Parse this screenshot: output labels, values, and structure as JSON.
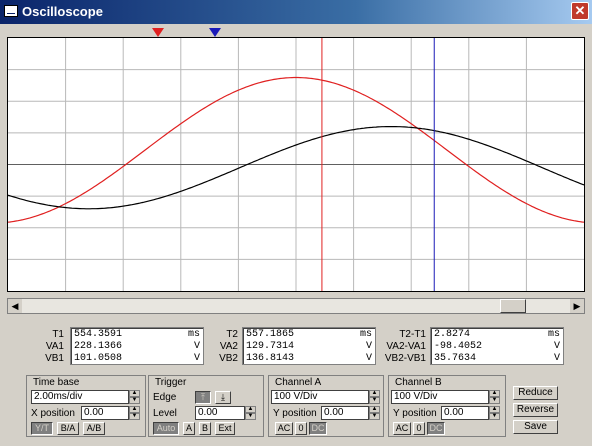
{
  "window": {
    "title": "Oscilloscope",
    "close_label": "✕",
    "icon": "oscilloscope-icon"
  },
  "cursors": {
    "c1_label": "1",
    "c2_label": "2",
    "c1_color": "#e02020",
    "c2_color": "#1a1ab8"
  },
  "chart_data": {
    "type": "line",
    "grid": true,
    "divisions": {
      "x": 10,
      "y": 8
    },
    "series": [
      {
        "color": "#e02020",
        "amplitude_div": 2.3,
        "offset_div": 0.45,
        "period_div": 10.5,
        "peak_at_div": 5.0
      },
      {
        "color": "#000000",
        "amplitude_div": 1.3,
        "offset_div": -0.1,
        "period_div": 10.5,
        "peak_at_div": 6.65
      }
    ],
    "cursor1_div": 5.45,
    "cursor2_div": 7.4
  },
  "readouts": {
    "left": {
      "labels": [
        "T1",
        "VA1",
        "VB1"
      ],
      "values": [
        "554.3591",
        "228.1366",
        "101.0508"
      ],
      "units": [
        "ms",
        "V",
        "V"
      ]
    },
    "mid": {
      "labels": [
        "T2",
        "VA2",
        "VB2"
      ],
      "values": [
        "557.1865",
        "129.7314",
        "136.8143"
      ],
      "units": [
        "ms",
        "V",
        "V"
      ]
    },
    "right": {
      "labels": [
        "T2-T1",
        "VA2-VA1",
        "VB2-VB1"
      ],
      "values": [
        "2.8274",
        "-98.4052",
        "35.7634"
      ],
      "units": [
        "ms",
        "V",
        "V"
      ]
    }
  },
  "timebase": {
    "title": "Time base",
    "value": "2.00ms/div",
    "xpos_label": "X position",
    "xpos": "0.00",
    "buttons": [
      "Y/T",
      "B/A",
      "A/B"
    ]
  },
  "trigger": {
    "title": "Trigger",
    "edge_label": "Edge",
    "level_label": "Level",
    "level": "0.00",
    "buttons": [
      "Auto",
      "A",
      "B",
      "Ext"
    ]
  },
  "channel_a": {
    "title": "Channel A",
    "value": "100 V/Div",
    "ypos_label": "Y position",
    "ypos": "0.00",
    "buttons": [
      "AC",
      "0",
      "DC"
    ]
  },
  "channel_b": {
    "title": "Channel B",
    "value": "100 V/Div",
    "ypos_label": "Y position",
    "ypos": "0.00",
    "buttons": [
      "AC",
      "0",
      "DC"
    ]
  },
  "actions": {
    "reduce": "Reduce",
    "reverse": "Reverse",
    "save": "Save"
  }
}
